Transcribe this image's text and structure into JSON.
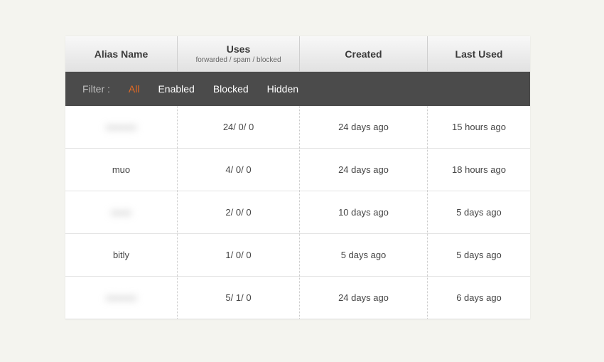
{
  "header": {
    "alias": "Alias Name",
    "uses": "Uses",
    "uses_sub": "forwarded / spam / blocked",
    "created": "Created",
    "last_used": "Last Used"
  },
  "filter": {
    "label": "Filter :",
    "options": {
      "all": "All",
      "enabled": "Enabled",
      "blocked": "Blocked",
      "hidden": "Hidden"
    }
  },
  "rows": [
    {
      "alias": "xxxxxx",
      "alias_redacted": true,
      "uses": "24/ 0/ 0",
      "created": "24 days ago",
      "last_used": "15 hours ago"
    },
    {
      "alias": "muo",
      "alias_redacted": false,
      "uses": "4/ 0/ 0",
      "created": "24 days ago",
      "last_used": "18 hours ago"
    },
    {
      "alias": "xxxx",
      "alias_redacted": true,
      "uses": "2/ 0/ 0",
      "created": "10 days ago",
      "last_used": "5 days ago"
    },
    {
      "alias": "bitly",
      "alias_redacted": false,
      "uses": "1/ 0/ 0",
      "created": "5 days ago",
      "last_used": "5 days ago"
    },
    {
      "alias": "xxxxxx",
      "alias_redacted": true,
      "uses": "5/ 1/ 0",
      "created": "24 days ago",
      "last_used": "6 days ago"
    }
  ]
}
